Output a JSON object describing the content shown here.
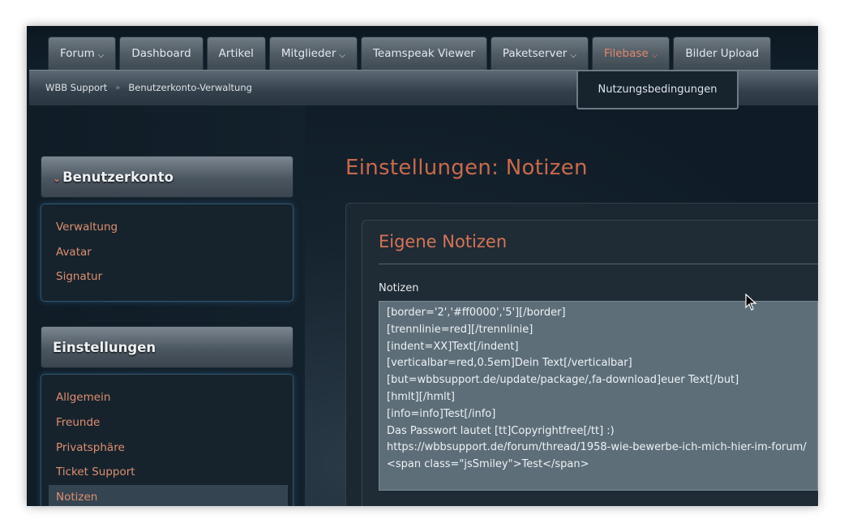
{
  "nav": {
    "items": [
      {
        "label": "Forum",
        "dropdown": true
      },
      {
        "label": "Dashboard",
        "dropdown": false
      },
      {
        "label": "Artikel",
        "dropdown": false
      },
      {
        "label": "Mitglieder",
        "dropdown": true
      },
      {
        "label": "Teamspeak Viewer",
        "dropdown": false
      },
      {
        "label": "Paketserver",
        "dropdown": true
      },
      {
        "label": "Filebase",
        "dropdown": true,
        "active": true
      },
      {
        "label": "Bilder Upload",
        "dropdown": false
      }
    ],
    "filebase_dropdown": {
      "items": [
        "Nutzungsbedingungen"
      ]
    }
  },
  "breadcrumb": {
    "items": [
      "WBB Support",
      "Benutzerkonto-Verwaltung"
    ],
    "separator": "»"
  },
  "sidebar": {
    "sections": [
      {
        "title": "Benutzerkonto",
        "collapse_icon": "chevron-down-icon",
        "links": [
          "Verwaltung",
          "Avatar",
          "Signatur"
        ]
      },
      {
        "title": "Einstellungen",
        "links": [
          "Allgemein",
          "Freunde",
          "Privatsphäre",
          "Ticket Support",
          "Notizen"
        ],
        "selected": "Notizen"
      }
    ]
  },
  "main": {
    "title": "Einstellungen: Notizen",
    "section_title": "Eigene Notizen",
    "field_label": "Notizen",
    "notes_lines": [
      "[border='2','#ff0000','5'][/border]",
      "[trennlinie=red][/trennlinie]",
      "[indent=XX]Text[/indent]",
      "[verticalbar=red,0.5em]Dein Text[/verticalbar]",
      "[but=wbbsupport.de/update/package/,fa-download]euer Text[/but]",
      "[hmlt][/hmlt]",
      "[info=info]Test[/info]",
      "Das Passwort lautet  [tt]Copyrightfree[/tt] :)",
      "https://wbbsupport.de/forum/thread/1958-wie-bewerbe-ich-mich-hier-im-forum/",
      "<span class=\"jsSmiley\">Test</span>"
    ]
  },
  "colors": {
    "accent": "#df8f6f",
    "title": "#c9694b",
    "background": "#0f1c27"
  }
}
